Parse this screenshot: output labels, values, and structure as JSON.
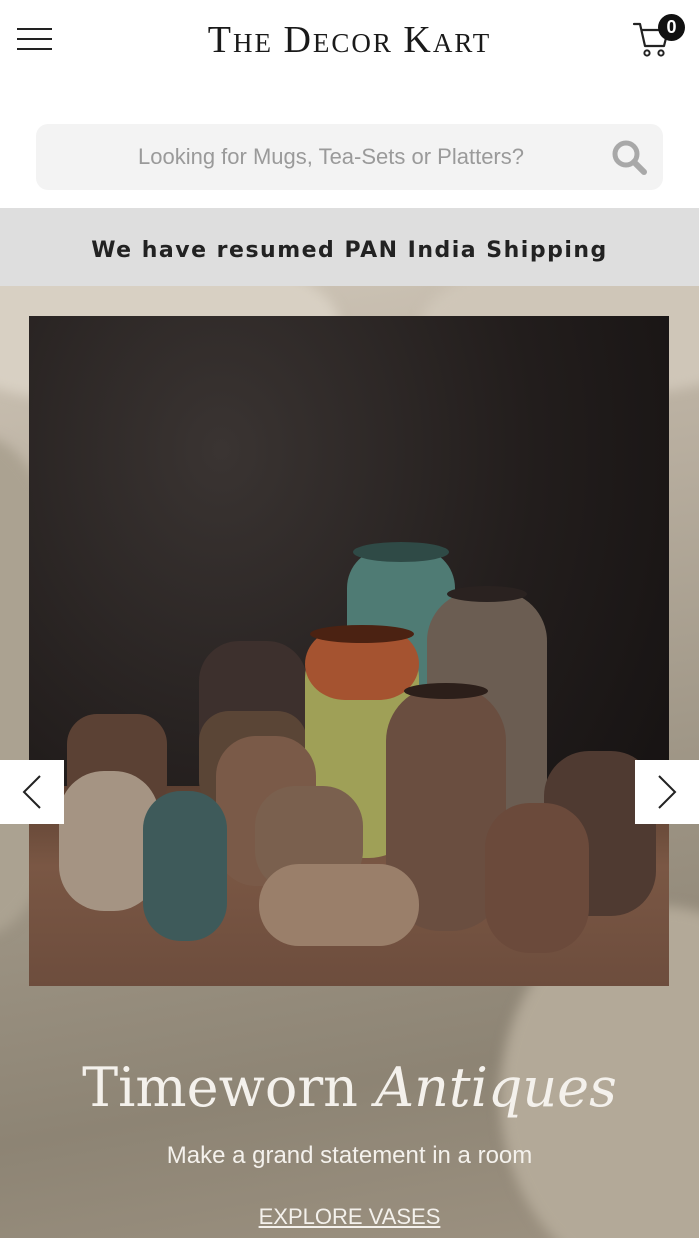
{
  "header": {
    "logo": {
      "t": "T",
      "he": "HE",
      "d": "D",
      "ecor": "ECOR",
      "k": "K",
      "art": "ART"
    },
    "cart_count": "0",
    "menu_icon": "hamburger-icon",
    "cart_icon": "cart-icon"
  },
  "search": {
    "placeholder": "Looking for Mugs, Tea-Sets or Platters?",
    "icon": "search-icon"
  },
  "announcement": "We have resumed PAN India Shipping",
  "hero": {
    "title_main": "Timeworn",
    "title_italic": "Antiques",
    "subtitle": "Make a grand statement in a room",
    "cta": "EXPLORE VASES",
    "prev_icon": "chevron-left-icon",
    "next_icon": "chevron-right-icon"
  },
  "colors": {
    "announcement_bg": "#dedede",
    "search_bg": "#f3f3f3",
    "text_dark": "#1a1a1a",
    "hero_text": "#f4f1ec"
  }
}
